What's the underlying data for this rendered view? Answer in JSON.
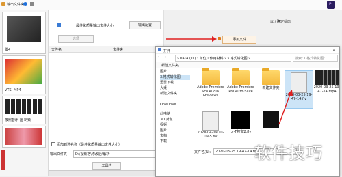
{
  "topbar": {
    "left_label": "输出文件夹",
    "app_logo": "Pr"
  },
  "sidebar": {
    "tiles": [
      {
        "caption": "脚4"
      },
      {
        "caption": "VTS -MP4"
      },
      {
        "caption": "按照音乐 画 制频"
      },
      {
        "caption": ""
      }
    ]
  },
  "main": {
    "row1_label": "最佳化质量输出文件大小",
    "btn_reset": "输出配置",
    "btn_add_file": "添加文件",
    "btn_options": "选项",
    "col_filename": "文件名",
    "col_size": "文件夹",
    "checkbox_label": "添加到选名称（最佳化质量输出文件大小）",
    "output_label": "输出文件夹",
    "output_path": "D:\\视频格\\修改后\\解析",
    "footer_btn": "工具栏"
  },
  "right_panel": {
    "header": "以 / 确定状态"
  },
  "dialog": {
    "title": "打开",
    "breadcrumb": "› DATA (D:) › 单位工作用材料 › 3.格式转化图 ›",
    "search_placeholder": "搜索\"3.格式转化图\"",
    "new_folder": "新建文件夹",
    "nav": [
      "图片",
      "3.格式转化图",
      "迅雷下载",
      "大桌",
      "新建文件夹",
      "OneDrive",
      "此电脑",
      "3D 对象",
      "视频",
      "图片",
      "文档",
      "下载"
    ],
    "files": [
      {
        "name": "Adobe Premiere Pro Audio Previews",
        "kind": "folder"
      },
      {
        "name": "Adobe Premiere Pro Auto-Save",
        "kind": "folder"
      },
      {
        "name": "新建文件夹",
        "kind": "folder"
      },
      {
        "name": "2020-03-25 19-47-14.flv",
        "kind": "flv"
      },
      {
        "name": "2020-03-25 19-47-14.mp4",
        "kind": "video"
      },
      {
        "name": "2020-04-09 10-09-5.flv",
        "kind": "flv"
      },
      {
        "name": "pr-F按文2.flv",
        "kind": "black"
      },
      {
        "name": "",
        "kind": "black"
      }
    ],
    "filename_label": "文件名(N):",
    "filename_value": "2020-03-25 19-47-14.flv"
  },
  "watermark": "软件技巧"
}
